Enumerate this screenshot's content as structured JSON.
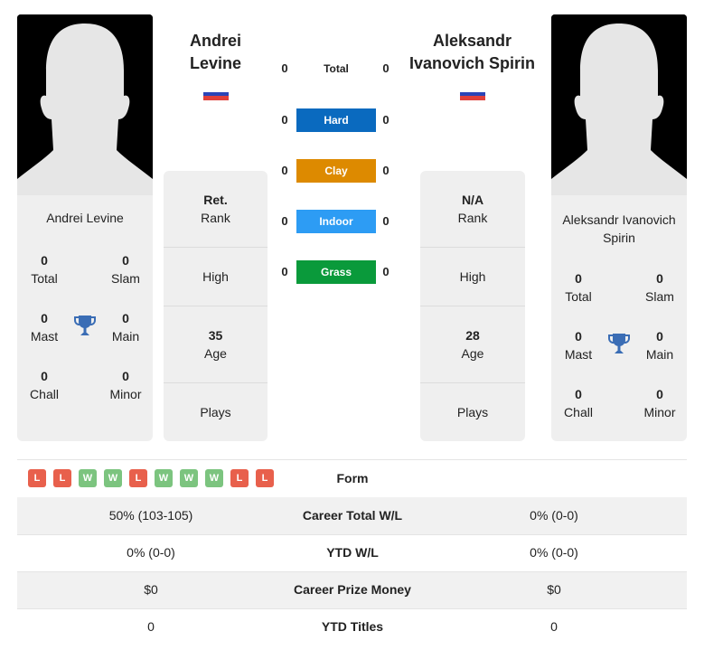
{
  "colors": {
    "hard": "#0a6abf",
    "clay": "#dd8a00",
    "indoor": "#2d9cf4",
    "grass": "#0a9a3b",
    "win": "#7cc47f",
    "loss": "#e8604c",
    "trophy": "#3a6db5"
  },
  "player1": {
    "name_line1": "Andrei",
    "name_line2": "Levine",
    "card_name": "Andrei Levine",
    "flag": "russia-flag",
    "rank_value": "Ret.",
    "rank_label": "Rank",
    "high_label": "High",
    "age_value": "35",
    "age_label": "Age",
    "plays_label": "Plays",
    "titles": {
      "total": "0",
      "total_label": "Total",
      "slam": "0",
      "slam_label": "Slam",
      "mast": "0",
      "mast_label": "Mast",
      "main": "0",
      "main_label": "Main",
      "chall": "0",
      "chall_label": "Chall",
      "minor": "0",
      "minor_label": "Minor"
    }
  },
  "player2": {
    "name_line1": "Aleksandr",
    "name_line2": "Ivanovich Spirin",
    "card_name_line1": "Aleksandr Ivanovich",
    "card_name_line2": "Spirin",
    "flag": "russia-flag",
    "rank_value": "N/A",
    "rank_label": "Rank",
    "high_label": "High",
    "age_value": "28",
    "age_label": "Age",
    "plays_label": "Plays",
    "titles": {
      "total": "0",
      "total_label": "Total",
      "slam": "0",
      "slam_label": "Slam",
      "mast": "0",
      "mast_label": "Mast",
      "main": "0",
      "main_label": "Main",
      "chall": "0",
      "chall_label": "Chall",
      "minor": "0",
      "minor_label": "Minor"
    }
  },
  "h2h": [
    {
      "label": "Total",
      "p1": "0",
      "p2": "0"
    },
    {
      "label": "Hard",
      "p1": "0",
      "p2": "0"
    },
    {
      "label": "Clay",
      "p1": "0",
      "p2": "0"
    },
    {
      "label": "Indoor",
      "p1": "0",
      "p2": "0"
    },
    {
      "label": "Grass",
      "p1": "0",
      "p2": "0"
    }
  ],
  "form": {
    "label": "Form",
    "results": [
      "L",
      "L",
      "W",
      "W",
      "L",
      "W",
      "W",
      "W",
      "L",
      "L"
    ]
  },
  "comparison": [
    {
      "label": "Career Total W/L",
      "p1": "50% (103-105)",
      "p2": "0% (0-0)"
    },
    {
      "label": "YTD W/L",
      "p1": "0% (0-0)",
      "p2": "0% (0-0)"
    },
    {
      "label": "Career Prize Money",
      "p1": "$0",
      "p2": "$0"
    },
    {
      "label": "YTD Titles",
      "p1": "0",
      "p2": "0"
    }
  ]
}
